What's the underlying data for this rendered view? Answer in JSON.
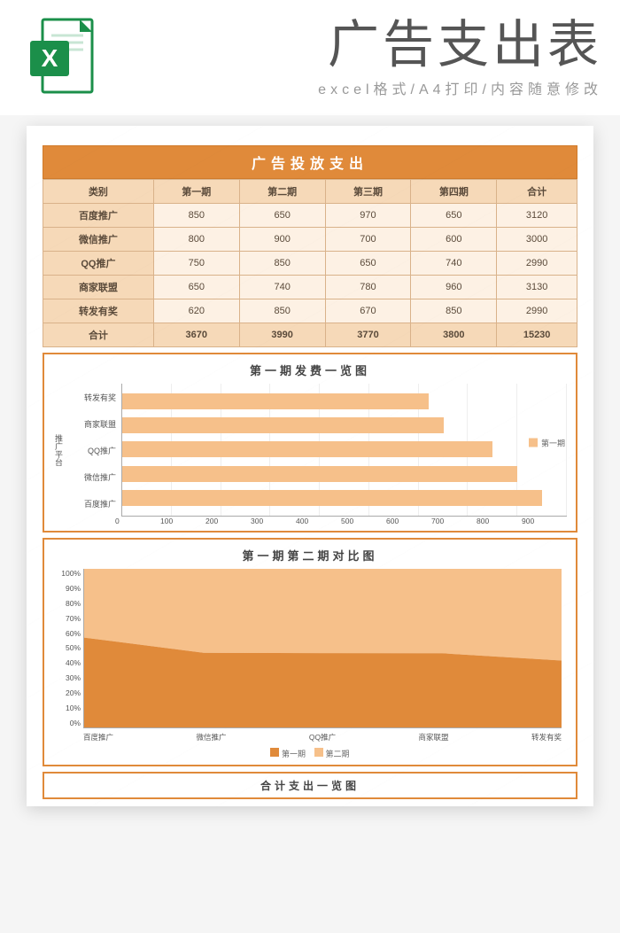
{
  "header": {
    "title": "广告支出表",
    "subtitle": "excel格式/A4打印/内容随意修改"
  },
  "sheet": {
    "title": "广告投放支出",
    "columns": [
      "类别",
      "第一期",
      "第二期",
      "第三期",
      "第四期",
      "合计"
    ],
    "rows": [
      {
        "label": "百度推广",
        "values": [
          850,
          650,
          970,
          650,
          3120
        ]
      },
      {
        "label": "微信推广",
        "values": [
          800,
          900,
          700,
          600,
          3000
        ]
      },
      {
        "label": "QQ推广",
        "values": [
          750,
          850,
          650,
          740,
          2990
        ]
      },
      {
        "label": "商家联盟",
        "values": [
          650,
          740,
          780,
          960,
          3130
        ]
      },
      {
        "label": "转发有奖",
        "values": [
          620,
          850,
          670,
          850,
          2990
        ]
      }
    ],
    "total": {
      "label": "合计",
      "values": [
        3670,
        3990,
        3770,
        3800,
        15230
      ]
    }
  },
  "chart_data": [
    {
      "type": "bar",
      "orientation": "horizontal",
      "title": "第一期发费一览图",
      "ylabel": "推广平台",
      "categories": [
        "转发有奖",
        "商家联盟",
        "QQ推广",
        "微信推广",
        "百度推广"
      ],
      "values": [
        620,
        650,
        750,
        800,
        850
      ],
      "xlim": [
        0,
        900
      ],
      "xticks": [
        0,
        100,
        200,
        300,
        400,
        500,
        600,
        700,
        800,
        900
      ],
      "legend": [
        "第一期"
      ]
    },
    {
      "type": "area",
      "title": "第一期第二期对比图",
      "stacked_percent": true,
      "categories": [
        "百度推广",
        "微信推广",
        "QQ推广",
        "商家联盟",
        "转发有奖"
      ],
      "series": [
        {
          "name": "第一期",
          "values": [
            850,
            800,
            750,
            650,
            620
          ]
        },
        {
          "name": "第二期",
          "values": [
            650,
            900,
            850,
            740,
            850
          ]
        }
      ],
      "yticks": [
        0,
        10,
        20,
        30,
        40,
        50,
        60,
        70,
        80,
        90,
        100
      ]
    }
  ],
  "bottom_chart_title": "合计支出一览图"
}
